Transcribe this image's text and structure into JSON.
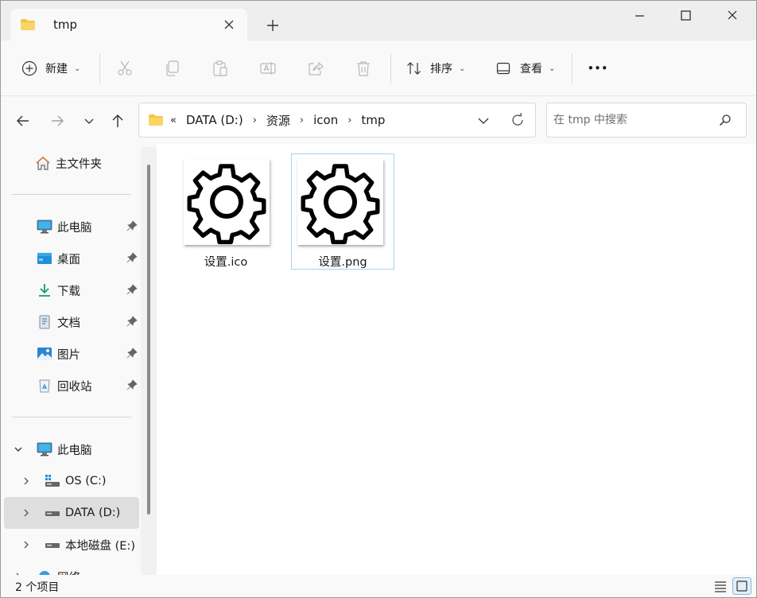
{
  "window": {
    "tab_title": "tmp",
    "new_tab_symbol": "+"
  },
  "toolbar": {
    "new_label": "新建",
    "sort_label": "排序",
    "view_label": "查看",
    "more_symbol": "•••",
    "icons": [
      "add-icon",
      "cut-icon",
      "copy-icon",
      "paste-icon",
      "rename-icon",
      "share-icon",
      "delete-icon",
      "sort-icon",
      "view-icon",
      "more-icon"
    ]
  },
  "address": {
    "overflow": "«",
    "crumbs": [
      "DATA (D:)",
      "资源",
      "icon",
      "tmp"
    ],
    "separator": "›"
  },
  "search": {
    "placeholder": "在 tmp 中搜索"
  },
  "sidebar": {
    "home": "主文件夹",
    "quick_access": [
      {
        "label": "此电脑",
        "icon": "computer-icon"
      },
      {
        "label": "桌面",
        "icon": "desktop-icon"
      },
      {
        "label": "下载",
        "icon": "download-icon"
      },
      {
        "label": "文档",
        "icon": "document-icon"
      },
      {
        "label": "图片",
        "icon": "pictures-icon"
      },
      {
        "label": "回收站",
        "icon": "recycle-bin-icon"
      }
    ],
    "this_pc": "此电脑",
    "drives": [
      {
        "label": "OS (C:)",
        "icon": "os-drive-icon"
      },
      {
        "label": "DATA (D:)",
        "icon": "drive-icon"
      },
      {
        "label": "本地磁盘 (E:)",
        "icon": "drive-icon"
      }
    ],
    "network": "网络"
  },
  "files": [
    {
      "name": "设置.ico",
      "icon": "gear-icon",
      "selected": false
    },
    {
      "name": "设置.png",
      "icon": "gear-icon",
      "selected": true
    }
  ],
  "status": {
    "item_count": "2 个项目"
  },
  "colors": {
    "folder": "#f5c342",
    "accent": "#0067c0",
    "selection_border": "#a8d2ec",
    "selected_item": "#dedede"
  }
}
